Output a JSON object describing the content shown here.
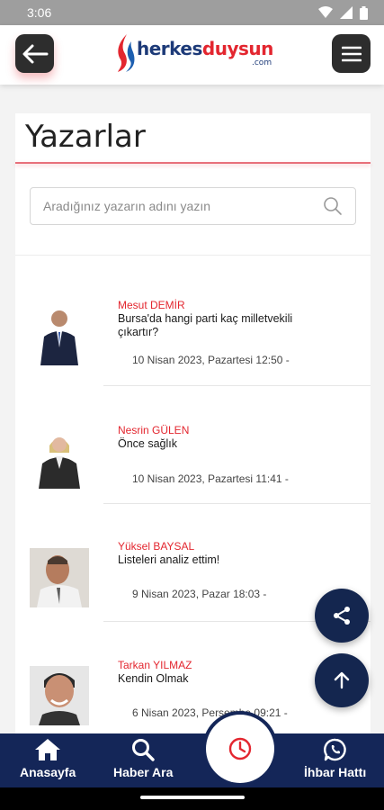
{
  "status": {
    "time": "3:06"
  },
  "header": {
    "logo_primary": "herkes",
    "logo_secondary": "duysun",
    "logo_suffix": ".com"
  },
  "page": {
    "title": "Yazarlar",
    "search_placeholder": "Aradığınız yazarın adını yazın"
  },
  "authors": [
    {
      "name": "Mesut DEMİR",
      "headline": "Bursa'da hangi parti kaç milletvekili çıkartır?",
      "date": "10 Nisan 2023, Pazartesi 12:50 -"
    },
    {
      "name": "Nesrin GÜLEN",
      "headline": "Önce sağlık",
      "date": "10 Nisan 2023, Pazartesi 11:41 -"
    },
    {
      "name": "Yüksel BAYSAL",
      "headline": "Listeleri analiz ettim!",
      "date": "9 Nisan 2023, Pazar 18:03 -"
    },
    {
      "name": "Tarkan YILMAZ",
      "headline": "Kendin Olmak",
      "date": "6 Nisan 2023, Perşembe 09:21 -"
    }
  ],
  "nav": {
    "home": "Anasayfa",
    "search": "Haber Ara",
    "tip_line": "İhbar Hattı"
  },
  "colors": {
    "brand_navy": "#142658",
    "brand_red": "#e3262f"
  }
}
